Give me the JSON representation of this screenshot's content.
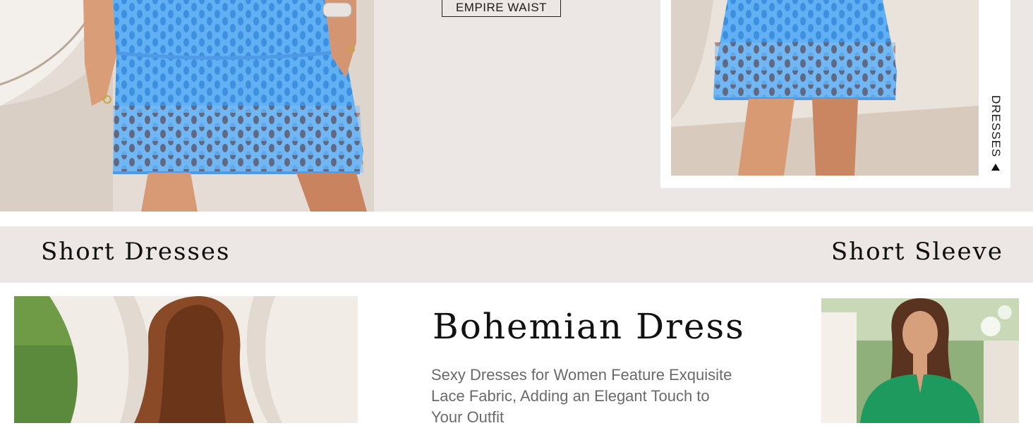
{
  "hero": {
    "tag_button_label": "EMPIRE WAIST",
    "side_label": "DRESSES",
    "side_arrow_icon": "triangle-up-icon"
  },
  "category_strip": {
    "left_title": "Short Dresses",
    "right_title": "Short Sleeve"
  },
  "feature": {
    "title": "Bohemian Dress",
    "description": "Sexy Dresses for Women Feature Exquisite Lace Fabric, Adding an Elegant Touch to Your Outfit"
  },
  "colors": {
    "band_background": "#ece6e5",
    "dress_blue": "#5aa9f0",
    "dress_green": "#1e9a5f",
    "text_dark": "#111111",
    "text_muted": "#6a6a6a"
  }
}
